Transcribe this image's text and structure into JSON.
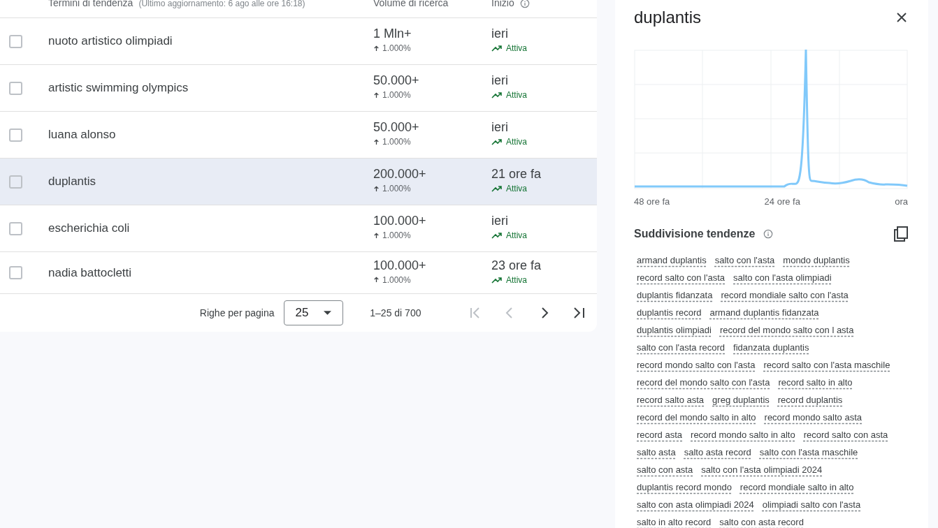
{
  "table": {
    "columns": [
      {
        "label": "Termini di tendenza",
        "note": "(Ultimo aggiornamento: 6 ago alle ore 16:18)"
      },
      {
        "label": "Volume di ricerca"
      },
      {
        "label": "Inizio",
        "info": true
      }
    ],
    "rows": [
      {
        "term": "nuoto artistico olimpiadi",
        "volume": "1 Mln+",
        "growth": "1.000%",
        "start": "ieri",
        "status": "Attiva",
        "checked": false,
        "selected": false
      },
      {
        "term": "artistic swimming olympics",
        "volume": "50.000+",
        "growth": "1.000%",
        "start": "ieri",
        "status": "Attiva",
        "checked": false,
        "selected": false
      },
      {
        "term": "luana alonso",
        "volume": "50.000+",
        "growth": "1.000%",
        "start": "ieri",
        "status": "Attiva",
        "checked": false,
        "selected": false
      },
      {
        "term": "duplantis",
        "volume": "200.000+",
        "growth": "1.000%",
        "start": "21 ore fa",
        "status": "Attiva",
        "checked": false,
        "selected": true
      },
      {
        "term": "escherichia coli",
        "volume": "100.000+",
        "growth": "1.000%",
        "start": "ieri",
        "status": "Attiva",
        "checked": false,
        "selected": false
      },
      {
        "term": "nadia battocletti",
        "volume": "100.000+",
        "growth": "1.000%",
        "start": "23 ore fa",
        "status": "Attiva",
        "checked": false,
        "selected": false
      }
    ]
  },
  "pagination": {
    "rows_label": "Righe per pagina",
    "rows_per_page": "25",
    "range": "1–25 di 700",
    "first_disabled": true,
    "prev_disabled": true
  },
  "panel": {
    "title": "duplantis",
    "chart": {
      "x_labels": [
        "48 ore fa",
        "24 ore fa",
        "ora"
      ]
    },
    "breakdown_title": "Suddivisione tendenze",
    "tags": [
      "armand duplantis",
      "salto con l'asta",
      "mondo duplantis",
      "record salto con l'asta",
      "salto con l'asta olimpiadi",
      "duplantis fidanzata",
      "record mondiale salto con l'asta",
      "duplantis record",
      "armand duplantis fidanzata",
      "duplantis olimpiadi",
      "record del mondo salto con l asta",
      "salto con l'asta record",
      "fidanzata duplantis",
      "record mondo salto con l'asta",
      "record salto con l'asta maschile",
      "record del mondo salto con l'asta",
      "record salto in alto",
      "record salto asta",
      "greg duplantis",
      "record duplantis",
      "record del mondo salto in alto",
      "record mondo salto asta",
      "record asta",
      "record mondo salto in alto",
      "record salto con asta",
      "salto asta",
      "salto asta record",
      "salto con l'asta maschile",
      "salto con asta",
      "salto con l'asta olimpiadi 2024",
      "duplantis record mondo",
      "record mondiale salto in alto",
      "salto con asta olimpiadi 2024",
      "olimpiadi salto con l'asta",
      "salto in alto record",
      "salto con asta record"
    ]
  }
}
